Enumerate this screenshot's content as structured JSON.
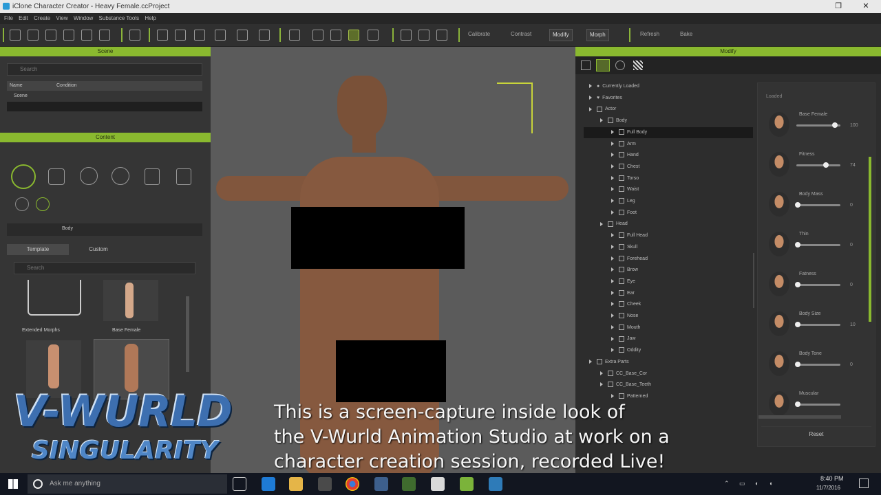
{
  "window": {
    "title": "iClone Character Creator - Heavy Female.ccProject"
  },
  "menu": [
    "File",
    "Edit",
    "Create",
    "View",
    "Window",
    "Substance Tools",
    "Help"
  ],
  "toolbar": {
    "calibrate": "Calibrate",
    "contrast": "Contrast",
    "modify": "Modify",
    "morph": "Morph",
    "refresh": "Refresh",
    "bake": "Bake"
  },
  "scene": {
    "header": "Scene",
    "search_placeholder": "Search",
    "col_name": "Name",
    "col_condition": "Condition",
    "root": "Scene"
  },
  "content": {
    "header": "Content",
    "path": "Body",
    "tab_template": "Template",
    "tab_custom": "Custom",
    "search_placeholder": "Search",
    "items": [
      "Extended Morphs",
      "Base Female"
    ]
  },
  "modify": {
    "header": "Modify",
    "tree": [
      {
        "label": "Currently Loaded",
        "depth": 0,
        "kind": "dot"
      },
      {
        "label": "Favorites",
        "depth": 0,
        "kind": "heart"
      },
      {
        "label": "Actor",
        "depth": 0,
        "kind": "check"
      },
      {
        "label": "Body",
        "depth": 1,
        "kind": "check"
      },
      {
        "label": "Full Body",
        "depth": 2,
        "kind": "check",
        "selected": true
      },
      {
        "label": "Arm",
        "depth": 2,
        "kind": "check"
      },
      {
        "label": "Hand",
        "depth": 2,
        "kind": "check"
      },
      {
        "label": "Chest",
        "depth": 2,
        "kind": "check"
      },
      {
        "label": "Torso",
        "depth": 2,
        "kind": "check"
      },
      {
        "label": "Waist",
        "depth": 2,
        "kind": "check"
      },
      {
        "label": "Leg",
        "depth": 2,
        "kind": "check"
      },
      {
        "label": "Foot",
        "depth": 2,
        "kind": "check"
      },
      {
        "label": "Head",
        "depth": 1,
        "kind": "check"
      },
      {
        "label": "Full Head",
        "depth": 2,
        "kind": "check"
      },
      {
        "label": "Skull",
        "depth": 2,
        "kind": "check"
      },
      {
        "label": "Forehead",
        "depth": 2,
        "kind": "check"
      },
      {
        "label": "Brow",
        "depth": 2,
        "kind": "check"
      },
      {
        "label": "Eye",
        "depth": 2,
        "kind": "check"
      },
      {
        "label": "Ear",
        "depth": 2,
        "kind": "check"
      },
      {
        "label": "Cheek",
        "depth": 2,
        "kind": "check"
      },
      {
        "label": "Nose",
        "depth": 2,
        "kind": "check"
      },
      {
        "label": "Mouth",
        "depth": 2,
        "kind": "check"
      },
      {
        "label": "Jaw",
        "depth": 2,
        "kind": "check"
      },
      {
        "label": "Oddity",
        "depth": 2,
        "kind": "check"
      },
      {
        "label": "Extra Parts",
        "depth": 0,
        "kind": "check"
      },
      {
        "label": "CC_Base_Cor",
        "depth": 1,
        "kind": "check"
      },
      {
        "label": "CC_Base_Teeth",
        "depth": 1,
        "kind": "check"
      },
      {
        "label": "Patterned",
        "depth": 2,
        "kind": "check"
      }
    ],
    "section_label": "Loaded",
    "params": [
      {
        "label": "Base Female",
        "value": "100",
        "level": 0.9
      },
      {
        "label": "Fitness",
        "value": "74",
        "level": 0.68
      },
      {
        "label": "Body Mass",
        "value": "0",
        "level": 0.0
      },
      {
        "label": "Thin",
        "value": "0",
        "level": 0.0
      },
      {
        "label": "Fatness",
        "value": "0",
        "level": 0.0
      },
      {
        "label": "Body Size",
        "value": "10",
        "level": 0.0
      },
      {
        "label": "Body Tone",
        "value": "0",
        "level": 0.0
      },
      {
        "label": "Muscular",
        "value": "",
        "level": 0.0
      }
    ],
    "reset": "Reset"
  },
  "watermark": {
    "line1": "V-WURLD",
    "line2": "SINGULARITY"
  },
  "caption": [
    "This is a screen-capture inside look of",
    "the V-Wurld Animation Studio at work on a",
    "character creation session, recorded Live!"
  ],
  "taskbar": {
    "search_placeholder": "Ask me anything",
    "time": "8:40 PM",
    "date": "11/7/2016"
  },
  "colors": {
    "accent": "#8ab92f",
    "viewport": "#5b5b5b",
    "taskbar": "#121620"
  }
}
